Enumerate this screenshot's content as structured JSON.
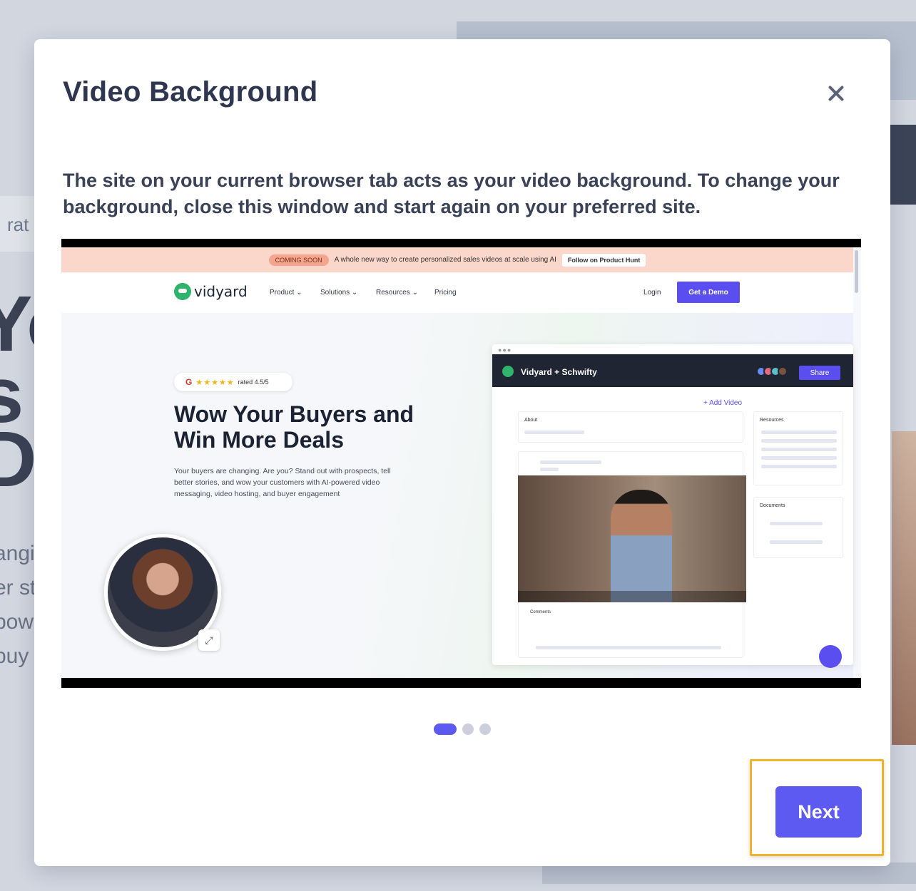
{
  "background": {
    "rating_text": "rat",
    "hero_lines": [
      "Yo",
      "s a",
      "D"
    ],
    "copy_lines": [
      "angi",
      "er st",
      "pow",
      "buy"
    ]
  },
  "modal": {
    "title": "Video Background",
    "description": "The site on your current browser tab acts as your video background. To change your background, close this window and start again on your preferred site.",
    "next_label": "Next",
    "carousel": {
      "count": 3,
      "active_index": 0
    }
  },
  "preview": {
    "banner": {
      "badge": "COMING SOON",
      "text": "A whole new way to create personalized sales videos at scale using AI",
      "button": "Follow on Product Hunt"
    },
    "nav": {
      "logo": "vidyard",
      "items": [
        "Product ⌄",
        "Solutions ⌄",
        "Resources ⌄",
        "Pricing"
      ],
      "login": "Login",
      "demo": "Get a Demo"
    },
    "hero": {
      "rating": "rated 4.5/5",
      "headline": "Wow Your Buyers and Win More Deals",
      "body": "Your buyers are changing. Are you? Stand out with prospects, tell better stories, and wow your customers with AI-powered video messaging, video hosting, and buyer engagement"
    },
    "app": {
      "title": "Vidyard + Schwifty",
      "share": "Share",
      "add_video": "+ Add Video",
      "about": "About",
      "resources": "Resources",
      "documents": "Documents",
      "comments": "Comments"
    }
  },
  "colors": {
    "accent": "#5c5af0",
    "highlight": "#f0b429",
    "title": "#2f3750"
  }
}
